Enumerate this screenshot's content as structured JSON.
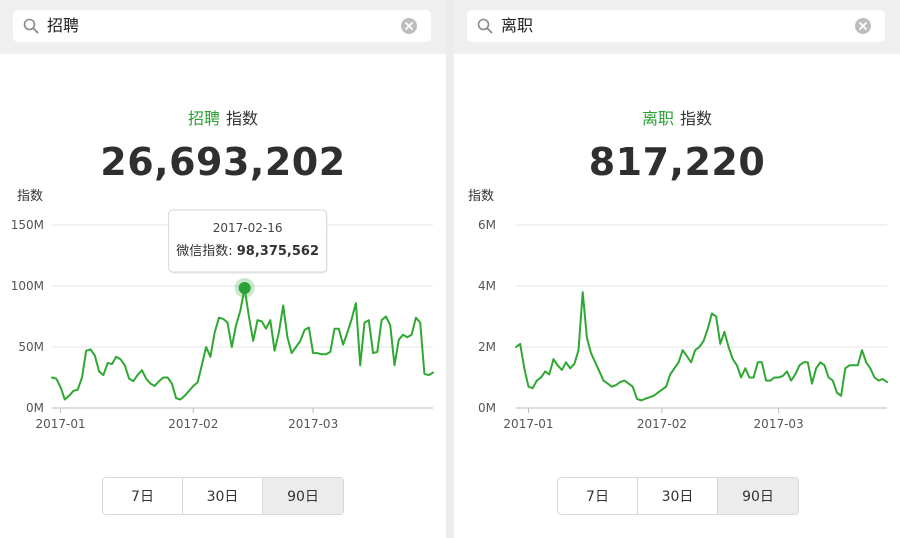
{
  "colors": {
    "accent": "#2ba234",
    "line": "#2fa832",
    "grid": "#e6e6e6"
  },
  "panels": [
    {
      "search": {
        "query": "招聘",
        "icon": "search-icon",
        "clear_icon": "clear-icon"
      },
      "title": {
        "keyword": "招聘",
        "suffix": "指数"
      },
      "total": "26,693,202",
      "tooltip": {
        "date": "2017-02-16",
        "label": "微信指数:",
        "value": "98,375,562"
      },
      "periods": [
        "7日",
        "30日",
        "90日"
      ],
      "active_period": "90日"
    },
    {
      "search": {
        "query": "离职",
        "icon": "search-icon",
        "clear_icon": "clear-icon"
      },
      "title": {
        "keyword": "离职",
        "suffix": "指数"
      },
      "total": "817,220",
      "periods": [
        "7日",
        "30日",
        "90日"
      ],
      "active_period": "90日"
    }
  ],
  "chart_data": [
    {
      "type": "line",
      "ylabel": "指数",
      "ylim": [
        0,
        150000000
      ],
      "yticks": [
        "0M",
        "50M",
        "100M",
        "150M"
      ],
      "xlim": [
        0,
        89
      ],
      "xticks": [
        {
          "label": "2017-01",
          "x": 2
        },
        {
          "label": "2017-02",
          "x": 33
        },
        {
          "label": "2017-03",
          "x": 61
        }
      ],
      "grid": true,
      "highlight_index": 45,
      "series": [
        {
          "values": [
            25000000,
            24000000,
            17000000,
            7000000,
            10000000,
            14000000,
            15000000,
            25000000,
            47000000,
            48000000,
            43000000,
            30000000,
            27000000,
            37000000,
            36000000,
            42000000,
            40000000,
            35000000,
            24000000,
            22000000,
            27000000,
            31000000,
            24000000,
            20000000,
            18000000,
            22000000,
            25000000,
            25000000,
            20000000,
            8000000,
            7000000,
            10000000,
            14000000,
            18000000,
            21000000,
            35000000,
            50000000,
            42000000,
            62000000,
            74000000,
            73000000,
            70000000,
            50000000,
            68000000,
            80000000,
            98375562,
            75000000,
            55000000,
            72000000,
            71000000,
            65000000,
            72000000,
            47000000,
            62000000,
            84000000,
            58000000,
            45000000,
            50000000,
            55000000,
            64000000,
            66000000,
            45000000,
            45000000,
            44000000,
            44000000,
            46000000,
            65000000,
            65000000,
            52000000,
            62000000,
            73000000,
            86000000,
            35000000,
            70000000,
            72000000,
            45000000,
            46000000,
            72000000,
            75000000,
            68000000,
            35000000,
            56000000,
            60000000,
            58000000,
            60000000,
            74000000,
            70000000,
            28000000,
            27000000,
            29000000
          ]
        }
      ]
    },
    {
      "type": "line",
      "ylabel": "指数",
      "ylim": [
        0,
        6000000
      ],
      "yticks": [
        "0M",
        "2M",
        "4M",
        "6M"
      ],
      "xlim": [
        0,
        89
      ],
      "xticks": [
        {
          "label": "2017-01",
          "x": 3
        },
        {
          "label": "2017-02",
          "x": 35
        },
        {
          "label": "2017-03",
          "x": 63
        }
      ],
      "grid": true,
      "series": [
        {
          "values": [
            2000000,
            2100000,
            1300000,
            700000,
            650000,
            900000,
            1000000,
            1200000,
            1100000,
            1600000,
            1400000,
            1250000,
            1500000,
            1300000,
            1450000,
            1900000,
            3800000,
            2300000,
            1800000,
            1500000,
            1200000,
            900000,
            800000,
            700000,
            750000,
            850000,
            900000,
            800000,
            700000,
            300000,
            250000,
            300000,
            350000,
            400000,
            500000,
            600000,
            700000,
            1100000,
            1300000,
            1500000,
            1900000,
            1700000,
            1500000,
            1900000,
            2000000,
            2200000,
            2600000,
            3100000,
            3000000,
            2100000,
            2500000,
            2000000,
            1600000,
            1400000,
            1000000,
            1300000,
            1000000,
            1000000,
            1500000,
            1500000,
            900000,
            900000,
            1000000,
            1000000,
            1050000,
            1200000,
            900000,
            1100000,
            1400000,
            1500000,
            1500000,
            800000,
            1300000,
            1500000,
            1400000,
            1000000,
            900000,
            500000,
            400000,
            1300000,
            1400000,
            1400000,
            1400000,
            1900000,
            1500000,
            1300000,
            1000000,
            900000,
            950000,
            850000
          ]
        }
      ]
    }
  ]
}
